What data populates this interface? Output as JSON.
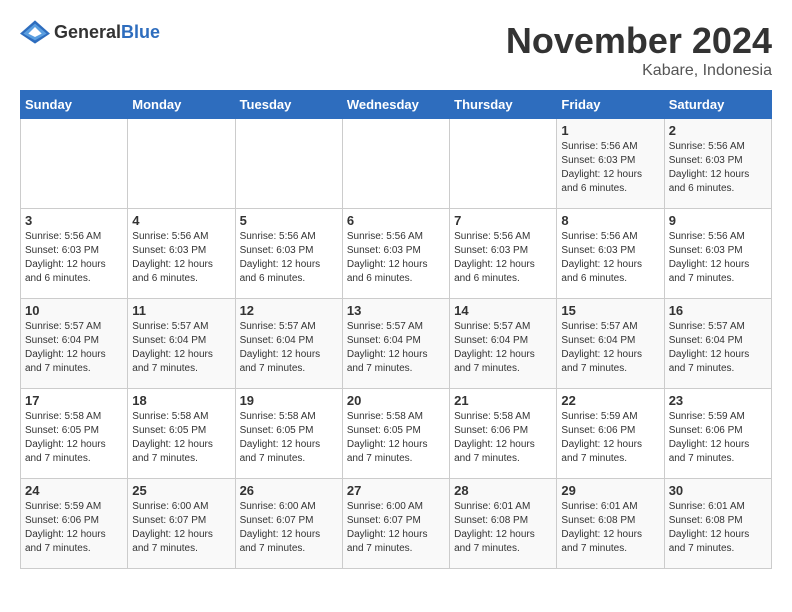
{
  "logo": {
    "text_general": "General",
    "text_blue": "Blue"
  },
  "header": {
    "month_title": "November 2024",
    "subtitle": "Kabare, Indonesia"
  },
  "weekdays": [
    "Sunday",
    "Monday",
    "Tuesday",
    "Wednesday",
    "Thursday",
    "Friday",
    "Saturday"
  ],
  "weeks": [
    [
      {
        "day": "",
        "info": ""
      },
      {
        "day": "",
        "info": ""
      },
      {
        "day": "",
        "info": ""
      },
      {
        "day": "",
        "info": ""
      },
      {
        "day": "",
        "info": ""
      },
      {
        "day": "1",
        "info": "Sunrise: 5:56 AM\nSunset: 6:03 PM\nDaylight: 12 hours and 6 minutes."
      },
      {
        "day": "2",
        "info": "Sunrise: 5:56 AM\nSunset: 6:03 PM\nDaylight: 12 hours and 6 minutes."
      }
    ],
    [
      {
        "day": "3",
        "info": "Sunrise: 5:56 AM\nSunset: 6:03 PM\nDaylight: 12 hours and 6 minutes."
      },
      {
        "day": "4",
        "info": "Sunrise: 5:56 AM\nSunset: 6:03 PM\nDaylight: 12 hours and 6 minutes."
      },
      {
        "day": "5",
        "info": "Sunrise: 5:56 AM\nSunset: 6:03 PM\nDaylight: 12 hours and 6 minutes."
      },
      {
        "day": "6",
        "info": "Sunrise: 5:56 AM\nSunset: 6:03 PM\nDaylight: 12 hours and 6 minutes."
      },
      {
        "day": "7",
        "info": "Sunrise: 5:56 AM\nSunset: 6:03 PM\nDaylight: 12 hours and 6 minutes."
      },
      {
        "day": "8",
        "info": "Sunrise: 5:56 AM\nSunset: 6:03 PM\nDaylight: 12 hours and 6 minutes."
      },
      {
        "day": "9",
        "info": "Sunrise: 5:56 AM\nSunset: 6:03 PM\nDaylight: 12 hours and 7 minutes."
      }
    ],
    [
      {
        "day": "10",
        "info": "Sunrise: 5:57 AM\nSunset: 6:04 PM\nDaylight: 12 hours and 7 minutes."
      },
      {
        "day": "11",
        "info": "Sunrise: 5:57 AM\nSunset: 6:04 PM\nDaylight: 12 hours and 7 minutes."
      },
      {
        "day": "12",
        "info": "Sunrise: 5:57 AM\nSunset: 6:04 PM\nDaylight: 12 hours and 7 minutes."
      },
      {
        "day": "13",
        "info": "Sunrise: 5:57 AM\nSunset: 6:04 PM\nDaylight: 12 hours and 7 minutes."
      },
      {
        "day": "14",
        "info": "Sunrise: 5:57 AM\nSunset: 6:04 PM\nDaylight: 12 hours and 7 minutes."
      },
      {
        "day": "15",
        "info": "Sunrise: 5:57 AM\nSunset: 6:04 PM\nDaylight: 12 hours and 7 minutes."
      },
      {
        "day": "16",
        "info": "Sunrise: 5:57 AM\nSunset: 6:04 PM\nDaylight: 12 hours and 7 minutes."
      }
    ],
    [
      {
        "day": "17",
        "info": "Sunrise: 5:58 AM\nSunset: 6:05 PM\nDaylight: 12 hours and 7 minutes."
      },
      {
        "day": "18",
        "info": "Sunrise: 5:58 AM\nSunset: 6:05 PM\nDaylight: 12 hours and 7 minutes."
      },
      {
        "day": "19",
        "info": "Sunrise: 5:58 AM\nSunset: 6:05 PM\nDaylight: 12 hours and 7 minutes."
      },
      {
        "day": "20",
        "info": "Sunrise: 5:58 AM\nSunset: 6:05 PM\nDaylight: 12 hours and 7 minutes."
      },
      {
        "day": "21",
        "info": "Sunrise: 5:58 AM\nSunset: 6:06 PM\nDaylight: 12 hours and 7 minutes."
      },
      {
        "day": "22",
        "info": "Sunrise: 5:59 AM\nSunset: 6:06 PM\nDaylight: 12 hours and 7 minutes."
      },
      {
        "day": "23",
        "info": "Sunrise: 5:59 AM\nSunset: 6:06 PM\nDaylight: 12 hours and 7 minutes."
      }
    ],
    [
      {
        "day": "24",
        "info": "Sunrise: 5:59 AM\nSunset: 6:06 PM\nDaylight: 12 hours and 7 minutes."
      },
      {
        "day": "25",
        "info": "Sunrise: 6:00 AM\nSunset: 6:07 PM\nDaylight: 12 hours and 7 minutes."
      },
      {
        "day": "26",
        "info": "Sunrise: 6:00 AM\nSunset: 6:07 PM\nDaylight: 12 hours and 7 minutes."
      },
      {
        "day": "27",
        "info": "Sunrise: 6:00 AM\nSunset: 6:07 PM\nDaylight: 12 hours and 7 minutes."
      },
      {
        "day": "28",
        "info": "Sunrise: 6:01 AM\nSunset: 6:08 PM\nDaylight: 12 hours and 7 minutes."
      },
      {
        "day": "29",
        "info": "Sunrise: 6:01 AM\nSunset: 6:08 PM\nDaylight: 12 hours and 7 minutes."
      },
      {
        "day": "30",
        "info": "Sunrise: 6:01 AM\nSunset: 6:08 PM\nDaylight: 12 hours and 7 minutes."
      }
    ]
  ]
}
